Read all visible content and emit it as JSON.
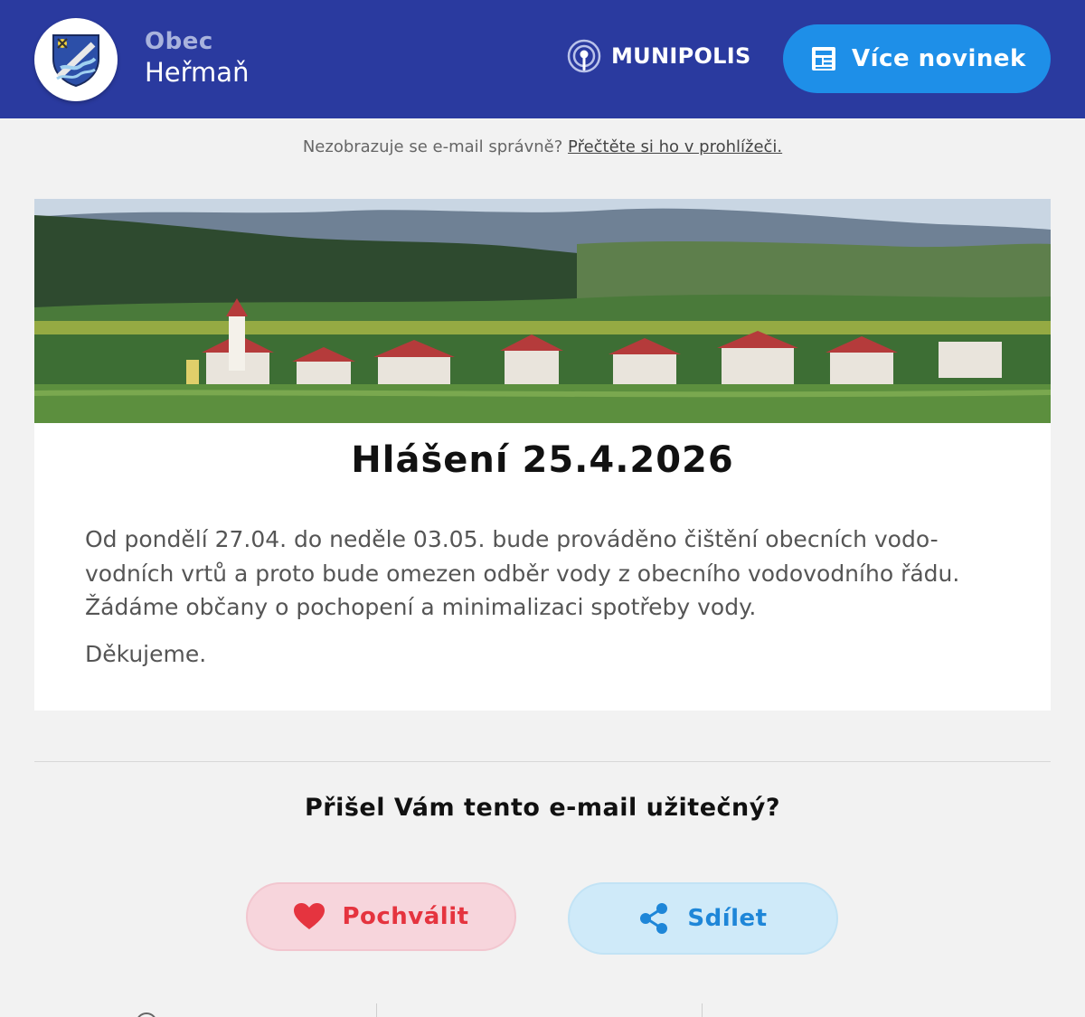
{
  "header": {
    "town_kind": "Obec",
    "town_name": "Heřmaň",
    "brand": "MUNIPOLIS",
    "more_news_label": "Více novinek",
    "background_color": "#2a3a9f",
    "accent_color": "#1e8fe8",
    "icons": {
      "logo": "coat-of-arms-icon",
      "brand": "munipolis-signal-icon",
      "more_news": "newspaper-icon"
    }
  },
  "browser_note": {
    "text": "Nezobrazuje se e-mail správně?",
    "link_label": "Přečtěte si ho v prohlížeči."
  },
  "article": {
    "hero_image": "village-panorama",
    "title": "Hlášení 25.4.2026",
    "body": "Od pondělí 27.04. do neděle 03.05. bude prováděno čištění obecních vodo-vodních vrtů a proto bude omezen odběr vody z obecního vodovodního řádu. Žádáme občany o pochopení a minimalizaci spotřeby vody.",
    "thanks": "Děkujeme."
  },
  "feedback": {
    "question": "Přišel Vám tento e-mail užitečný?",
    "praise_label": "Pochválit",
    "share_label": "Sdílet",
    "praise_color": "#e5343f",
    "share_color": "#1e86d8",
    "icons": {
      "praise": "heart-icon",
      "share": "share-icon"
    }
  }
}
